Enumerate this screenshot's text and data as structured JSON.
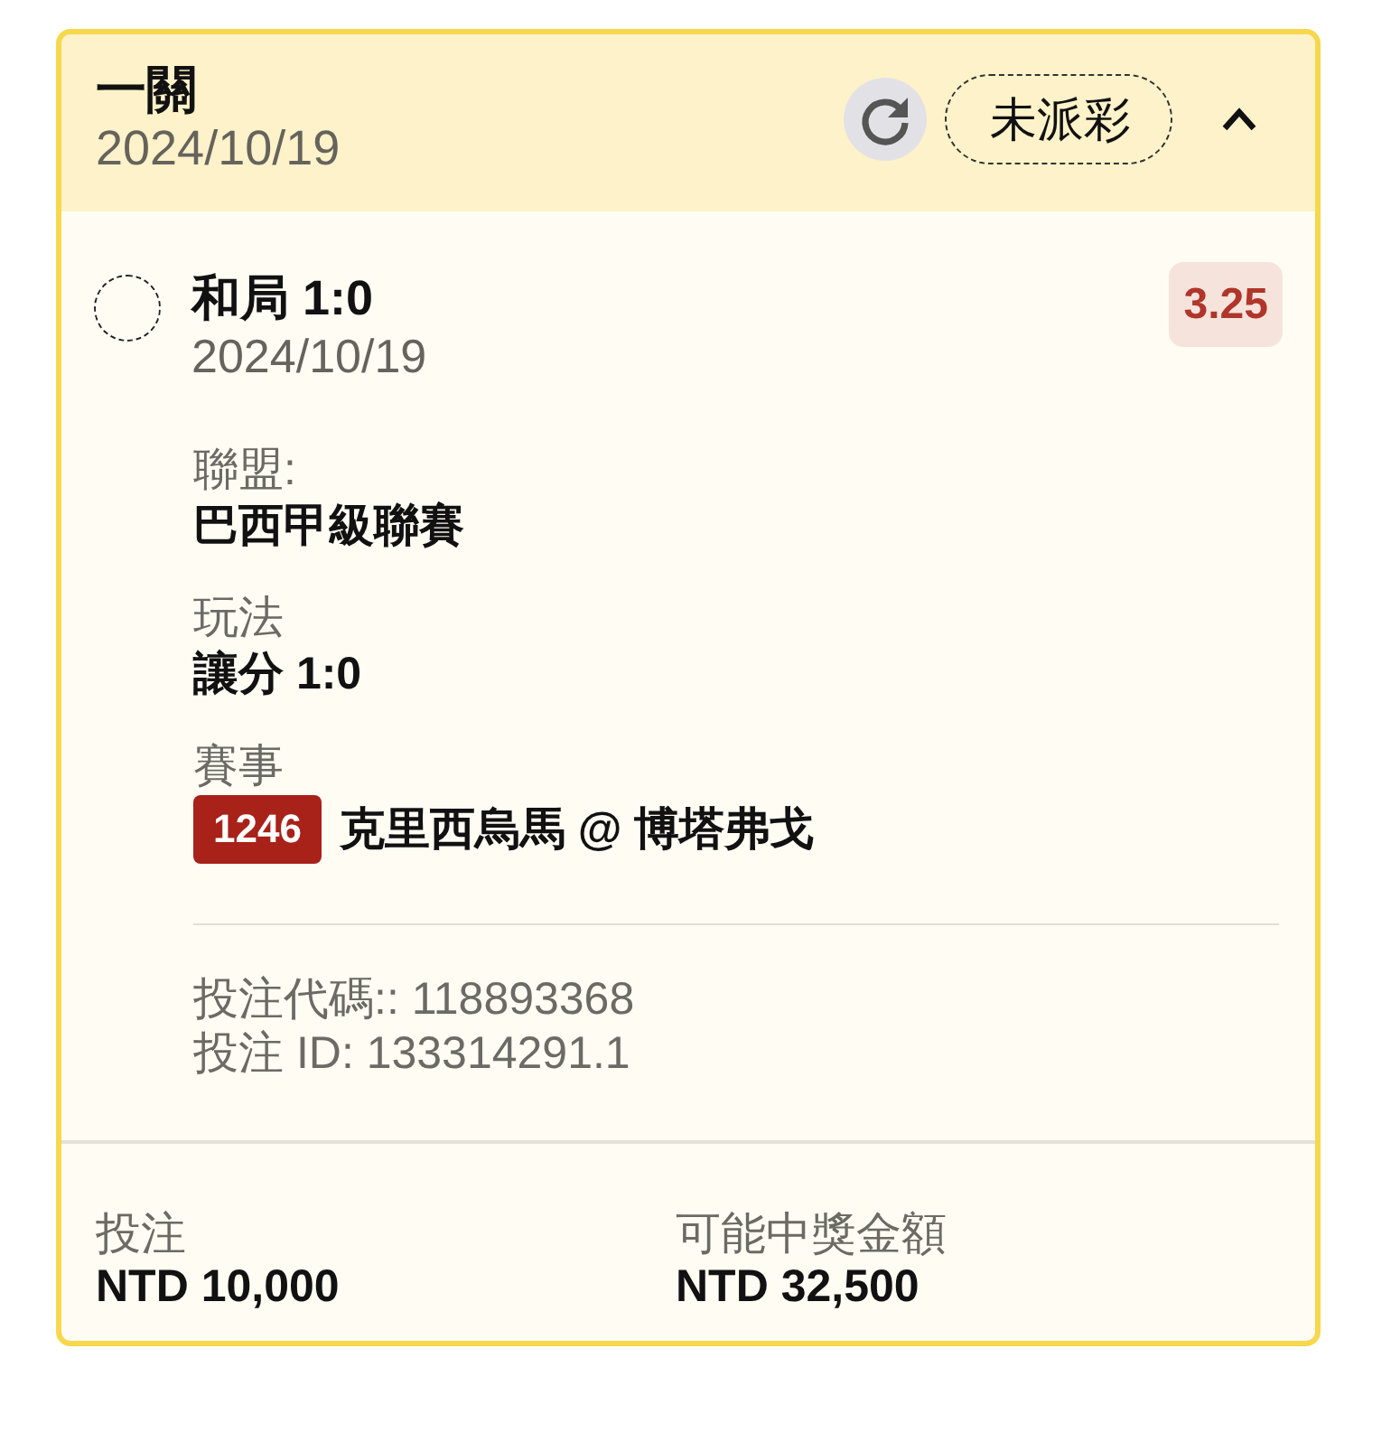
{
  "ticket": {
    "title": "一關",
    "date": "2024/10/19",
    "status": "未派彩",
    "expanded": true
  },
  "selection": {
    "name": "和局 1:0",
    "date": "2024/10/19",
    "odds": "3.25",
    "selected": false
  },
  "details": [
    {
      "kind": "text",
      "label": "聯盟:",
      "value": "巴西甲級聯賽"
    },
    {
      "kind": "text",
      "label": "玩法",
      "value": "讓分 1:0"
    },
    {
      "kind": "event",
      "label": "賽事",
      "event_no": "1246",
      "value": "克里西烏馬 @ 博塔弗戈"
    }
  ],
  "codes": [
    "投注代碼:: 118893368",
    "投注 ID: 133314291.1"
  ],
  "footer": [
    {
      "label": "投注",
      "value": "NTD 10,000"
    },
    {
      "label": "可能中獎金額",
      "value": "NTD 32,500"
    }
  ]
}
